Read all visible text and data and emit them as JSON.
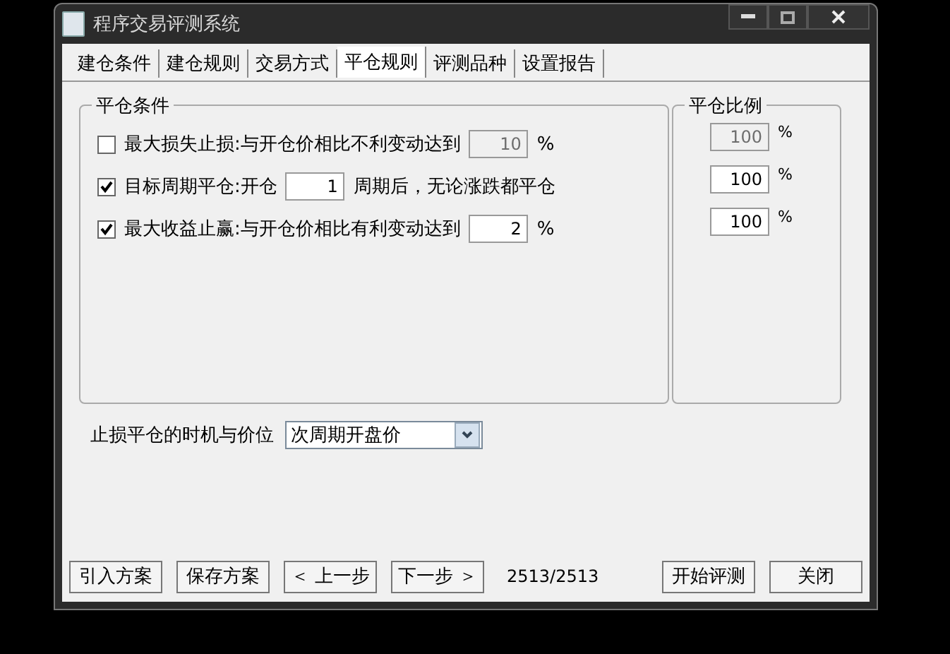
{
  "window": {
    "title": "程序交易评测系统"
  },
  "tabs": [
    {
      "label": "建仓条件",
      "selected": false
    },
    {
      "label": "建仓规则",
      "selected": false
    },
    {
      "label": "交易方式",
      "selected": false
    },
    {
      "label": "平仓规则",
      "selected": true
    },
    {
      "label": "评测品种",
      "selected": false
    },
    {
      "label": "设置报告",
      "selected": false
    }
  ],
  "conditions": {
    "title": "平仓条件",
    "rows": [
      {
        "checked": false,
        "label": "最大损失止损:与开仓价相比不利变动达到",
        "value": "10",
        "disabled": true,
        "after": "%"
      },
      {
        "checked": true,
        "label": "目标周期平仓:开仓",
        "value": "1",
        "disabled": false,
        "after": "周期后，无论涨跌都平仓"
      },
      {
        "checked": true,
        "label": "最大收益止赢:与开仓价相比有利变动达到",
        "value": "2",
        "disabled": false,
        "after": "%"
      }
    ]
  },
  "ratios": {
    "title": "平仓比例",
    "rows": [
      {
        "value": "100",
        "disabled": true,
        "unit": "%"
      },
      {
        "value": "100",
        "disabled": false,
        "unit": "%"
      },
      {
        "value": "100",
        "disabled": false,
        "unit": "%"
      }
    ]
  },
  "timing": {
    "label": "止损平仓的时机与价位",
    "value": "次周期开盘价"
  },
  "footer": {
    "buttons_left": [
      "引入方案",
      "保存方案",
      "＜ 上一步",
      "下一步 ＞"
    ],
    "counter": "2513/2513",
    "buttons_right": [
      "开始评测",
      "关闭"
    ]
  }
}
